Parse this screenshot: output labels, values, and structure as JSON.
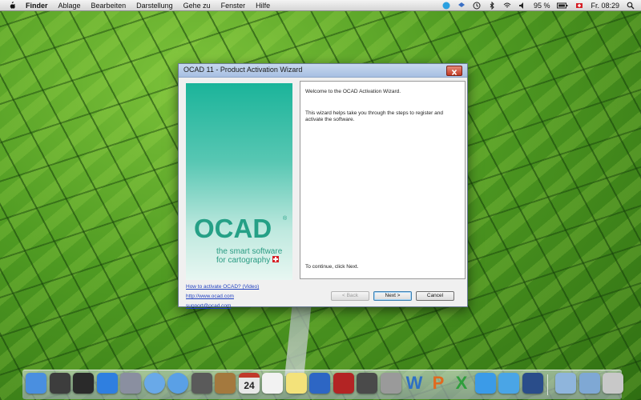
{
  "menubar": {
    "app": "Finder",
    "items": [
      "Ablage",
      "Bearbeiten",
      "Darstellung",
      "Gehe zu",
      "Fenster",
      "Hilfe"
    ],
    "battery": "95 %",
    "clock": "Fr. 08:29"
  },
  "window": {
    "title": "OCAD 11 - Product Activation Wizard",
    "logo": {
      "wordmark": "OCAD",
      "registered": "®",
      "tagline_line1": "the smart software",
      "tagline_line2": "for cartography"
    },
    "content": {
      "welcome": "Welcome to the OCAD Activation Wizard.",
      "description": "This wizard helps take you through the steps to register and activate the software.",
      "continue": "To continue, click Next."
    },
    "links": {
      "how_to": "How to activate OCAD? (Video)",
      "website": "http://www.ocad.com",
      "email": "support@ocad.com"
    },
    "buttons": {
      "back": "< Back",
      "next": "Next >",
      "cancel": "Cancel"
    }
  },
  "dock": {
    "items": [
      {
        "name": "finder-icon",
        "color": "#4a8fe0"
      },
      {
        "name": "dashboard-icon",
        "color": "#3d3d3d"
      },
      {
        "name": "mission-control-icon",
        "color": "#2a2a2a"
      },
      {
        "name": "app-store-icon",
        "color": "#2f7fe0"
      },
      {
        "name": "preview-icon",
        "color": "#8a8fa0"
      },
      {
        "name": "ichat-icon",
        "color": "#69a9e8"
      },
      {
        "name": "safari-icon",
        "color": "#5aa0e6"
      },
      {
        "name": "facetime-icon",
        "color": "#5a5a5a"
      },
      {
        "name": "address-book-icon",
        "color": "#a4793e"
      },
      {
        "name": "calendar-icon",
        "color": "#e8e8e8"
      },
      {
        "name": "textedit-icon",
        "color": "#f2f2f2"
      },
      {
        "name": "stickies-icon",
        "color": "#f3e27a"
      },
      {
        "name": "itunes-icon",
        "color": "#2d66c4"
      },
      {
        "name": "photo-booth-icon",
        "color": "#b32424"
      },
      {
        "name": "iphoto-icon",
        "color": "#4a4a4a"
      },
      {
        "name": "system-preferences-icon",
        "color": "#9a9a9a"
      },
      {
        "name": "word-icon",
        "color": "#2d6fc4"
      },
      {
        "name": "powerpoint-icon",
        "color": "#e06a1f"
      },
      {
        "name": "excel-icon",
        "color": "#2f9e3c"
      },
      {
        "name": "windows-icon",
        "color": "#3b9be8"
      },
      {
        "name": "twitter-icon",
        "color": "#4aa5e6"
      },
      {
        "name": "virtualbox-icon",
        "color": "#2a4d8a"
      },
      {
        "name": "applications-folder-icon",
        "color": "#8fb5dc"
      },
      {
        "name": "downloads-folder-icon",
        "color": "#7fa8d4"
      },
      {
        "name": "trash-icon",
        "color": "#c8c8c8"
      }
    ],
    "letters": {
      "word": "W",
      "powerpoint": "P",
      "excel": "X"
    },
    "calendar_day": "24"
  }
}
